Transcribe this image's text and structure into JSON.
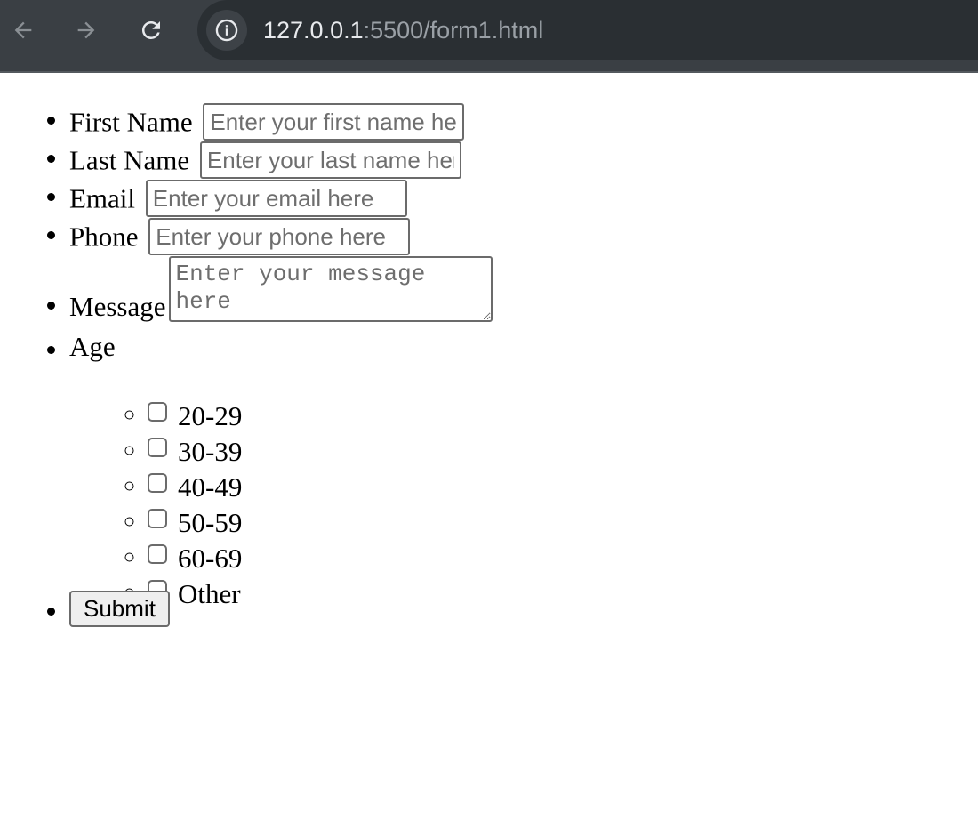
{
  "browser": {
    "url_host": "127.0.0.1",
    "url_path": ":5500/form1.html",
    "colors": {
      "toolbar": "#3a3f44",
      "omnibox": "#2a2f33",
      "url_host": "#e8eaed",
      "url_path": "#9aa0a6"
    }
  },
  "form": {
    "first_name": {
      "label": "First Name",
      "placeholder": "Enter your first name here",
      "value": ""
    },
    "last_name": {
      "label": "Last Name",
      "placeholder": "Enter your last name here",
      "value": ""
    },
    "email": {
      "label": "Email",
      "placeholder": "Enter your email here",
      "value": ""
    },
    "phone": {
      "label": "Phone",
      "placeholder": "Enter your phone here",
      "value": ""
    },
    "message": {
      "label": "Message",
      "placeholder": "Enter your message here",
      "value": ""
    },
    "age": {
      "label": "Age",
      "options": [
        {
          "label": "20-29",
          "checked": false
        },
        {
          "label": "30-39",
          "checked": false
        },
        {
          "label": "40-49",
          "checked": false
        },
        {
          "label": "50-59",
          "checked": false
        },
        {
          "label": "60-69",
          "checked": false
        },
        {
          "label": "Other",
          "checked": false
        }
      ]
    },
    "submit_label": "Submit"
  }
}
